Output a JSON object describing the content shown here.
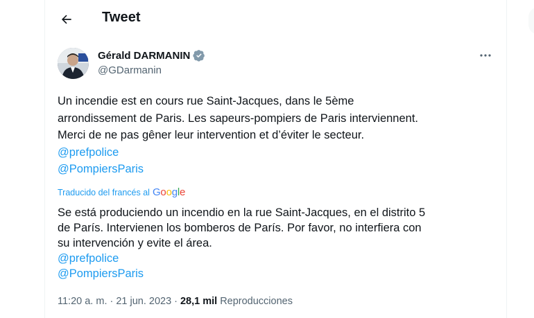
{
  "header": {
    "title": "Tweet"
  },
  "author": {
    "name": "Gérald DARMANIN",
    "handle": "@GDarmanin"
  },
  "tweet": {
    "text_lines": [
      "Un incendie est en cours rue Saint-Jacques, dans le 5ème",
      "arrondissement de Paris. Les sapeurs-pompiers de Paris interviennent.",
      "Merci de ne pas gêner leur intervention et d’éviter le secteur."
    ],
    "mentions": [
      "@prefpolice",
      "@PompiersParis"
    ]
  },
  "translation": {
    "label": "Traducido del francés al",
    "provider": {
      "g1": "G",
      "o1": "o",
      "o2": "o",
      "g2": "g",
      "l": "l",
      "e": "e"
    },
    "text_lines": [
      "Se está produciendo un incendio en la rue Saint-Jacques, en el distrito 5",
      "de París. Intervienen los bomberos de París. Por favor, no interfiera con",
      "su intervención y evite el área."
    ],
    "mentions": [
      "@prefpolice",
      "@PompiersParis"
    ]
  },
  "meta": {
    "time": "11:20 a. m.",
    "separator": "·",
    "date": "21 jun. 2023",
    "separator2": "·",
    "views_count": "28,1 mil",
    "views_label": "Reproducciones"
  },
  "icons": {
    "back": "back-arrow-icon",
    "verified": "verified-badge-icon",
    "more": "more-dots-icon"
  },
  "colors": {
    "accent": "#1d9bf0",
    "text": "#0f1419",
    "secondary": "#536471"
  }
}
